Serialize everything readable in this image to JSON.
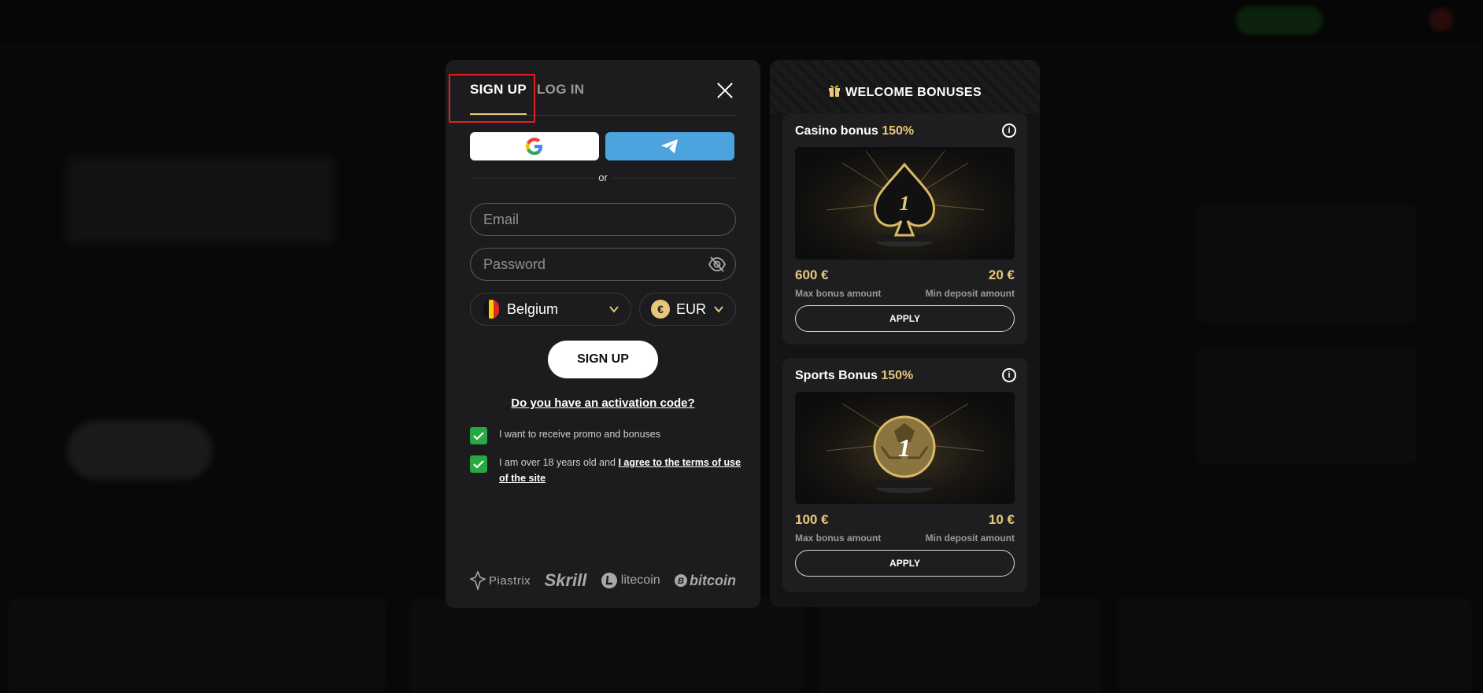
{
  "signup": {
    "tabs": [
      {
        "label": "SIGN UP"
      },
      {
        "label": "LOG IN"
      }
    ],
    "or": "or",
    "email_placeholder": "Email",
    "password_placeholder": "Password",
    "country": "Belgium",
    "currency": "EUR",
    "currency_symbol": "€",
    "submit_label": "SIGN UP",
    "activation_link": "Do you have an activation code?",
    "checkbox_promo": "I want to receive promo and bonuses",
    "checkbox_terms_prefix": "I am over 18 years old and ",
    "checkbox_terms_link": "I agree to the terms of use of the site",
    "payments": [
      "Piastrix",
      "Skrill",
      "litecoin",
      "bitcoin"
    ]
  },
  "bonuses": {
    "title": "WELCOME BONUSES",
    "cards": [
      {
        "name": "Casino bonus",
        "percent": "150%",
        "image_number": "1",
        "max_amount": "600 €",
        "max_label": "Max bonus amount",
        "min_deposit": "20 €",
        "min_label": "Min deposit amount",
        "apply_label": "APPLY"
      },
      {
        "name": "Sports Bonus",
        "percent": "150%",
        "image_number": "1",
        "max_amount": "100 €",
        "max_label": "Max bonus amount",
        "min_deposit": "10 €",
        "min_label": "Min deposit amount",
        "apply_label": "APPLY"
      }
    ]
  },
  "colors": {
    "accent_gold": "#e8c77a",
    "telegram_blue": "#4ca3dd",
    "check_green": "#28a745",
    "highlight_red": "#e02020"
  }
}
